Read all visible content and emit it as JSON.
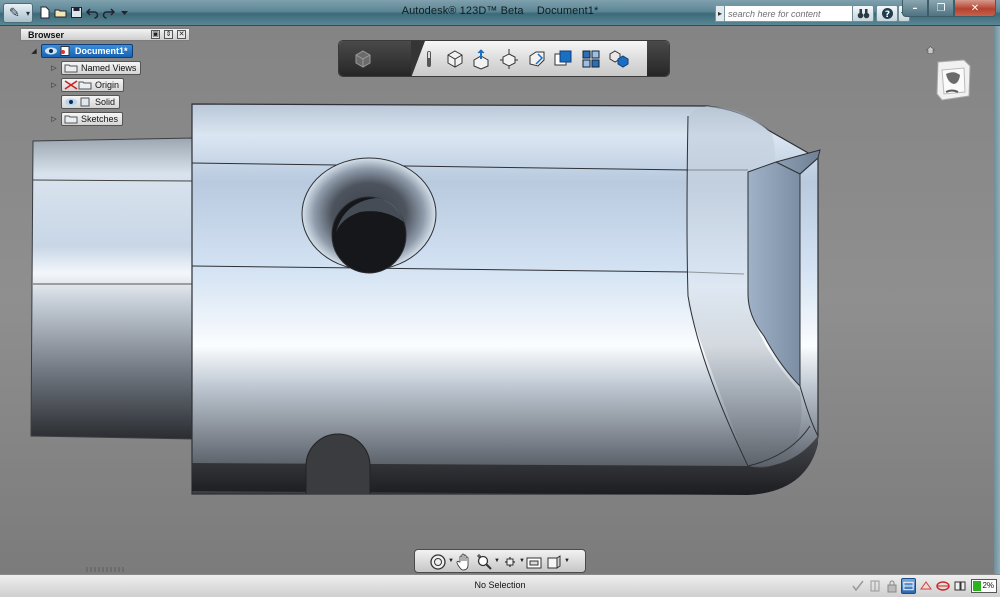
{
  "titlebar": {
    "app_name": "Autodesk® 123D™ Beta",
    "document_name": "Document1*",
    "search_placeholder": "search here for content",
    "quick_access": [
      "new-file-icon",
      "open-folder-icon",
      "save-icon",
      "undo-icon",
      "redo-icon",
      "customize-dropdown-icon"
    ],
    "window_buttons": [
      "minimize",
      "restore",
      "close"
    ]
  },
  "browser": {
    "title": "Browser",
    "root": {
      "label": "Document1*"
    },
    "items": [
      {
        "label": "Named Views",
        "icon": "folder-icon",
        "expandable": true
      },
      {
        "label": "Origin",
        "icon": "folder-hidden-icon",
        "expandable": true
      },
      {
        "label": "Solid",
        "icon": "solid-body-icon",
        "expandable": false
      },
      {
        "label": "Sketches",
        "icon": "folder-icon",
        "expandable": true
      }
    ]
  },
  "view_toolbar": {
    "buttons": [
      "ribbon-icon",
      "pointer-icon",
      "box-icon",
      "extrude-icon",
      "move-icon",
      "fillet-icon",
      "shaded-view-icon",
      "grid-view-icon",
      "assembly-icon"
    ]
  },
  "nav_bar": {
    "buttons": [
      "orbit-icon",
      "pan-icon",
      "zoom-icon",
      "look-at-icon",
      "fit-icon",
      "display-mode-icon"
    ]
  },
  "status": {
    "selection": "No Selection",
    "icons": [
      "check-icon",
      "section-icon",
      "lock-icon",
      "view-toggle-icon",
      "snap-icon",
      "grid-snap-icon",
      "layout-icon"
    ],
    "battery_percent": "2%",
    "battery_level": 0.02
  },
  "colors": {
    "titlebar": "#5d8796",
    "viewport_bg": "#8a8a8a",
    "model_highlight": "#e7eff8",
    "model_shadow": "#2e3034",
    "selected_node": "#1b62b3"
  }
}
